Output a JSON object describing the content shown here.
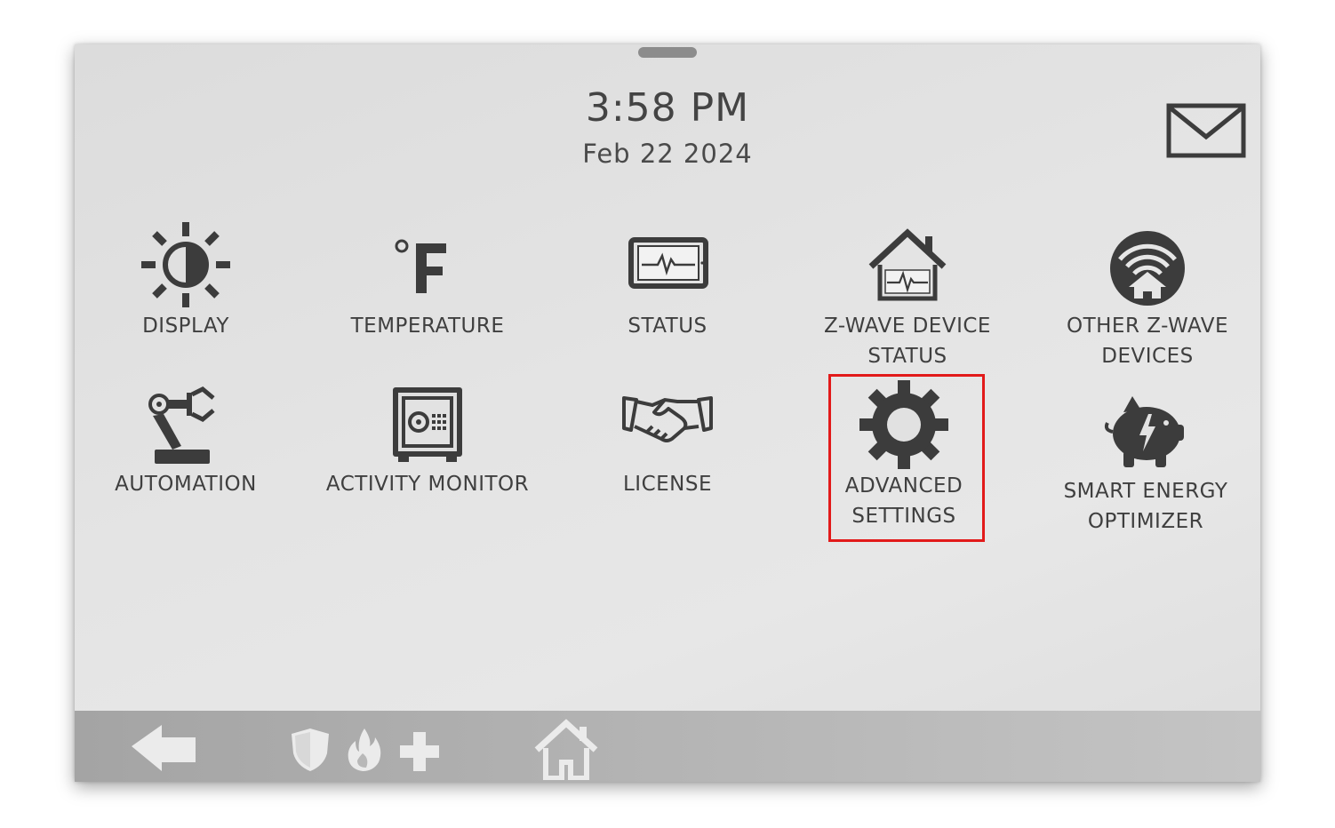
{
  "header": {
    "time": "3:58 PM",
    "date": "Feb 22 2024"
  },
  "tiles": [
    {
      "label": "DISPLAY",
      "icon": "brightness-icon"
    },
    {
      "label": "TEMPERATURE",
      "icon": "fahrenheit-icon"
    },
    {
      "label": "STATUS",
      "icon": "tablet-heartbeat-icon"
    },
    {
      "label": "Z-WAVE DEVICE\nSTATUS",
      "icon": "house-heartbeat-icon"
    },
    {
      "label": "OTHER Z-WAVE\nDEVICES",
      "icon": "wifi-home-icon"
    },
    {
      "label": "AUTOMATION",
      "icon": "robot-arm-icon"
    },
    {
      "label": "ACTIVITY MONITOR",
      "icon": "safe-icon"
    },
    {
      "label": "LICENSE",
      "icon": "handshake-icon"
    },
    {
      "label": "ADVANCED\nSETTINGS",
      "icon": "gear-icon"
    },
    {
      "label": "SMART ENERGY\nOPTIMIZER",
      "icon": "piggy-bank-icon"
    }
  ],
  "highlighted_tile": "ADVANCED SETTINGS",
  "colors": {
    "screen_bg": "#e2e2e2",
    "icon": "#3c3c3c",
    "text": "#3f3f3f",
    "highlight": "#e21a1a",
    "bottom_bar": "#b1b1b1",
    "bottom_icons": "#ebebeb"
  },
  "bottom_bar": {
    "buttons": [
      "back-arrow-icon",
      "shield-icon",
      "fire-icon",
      "medical-plus-icon",
      "home-icon"
    ]
  }
}
